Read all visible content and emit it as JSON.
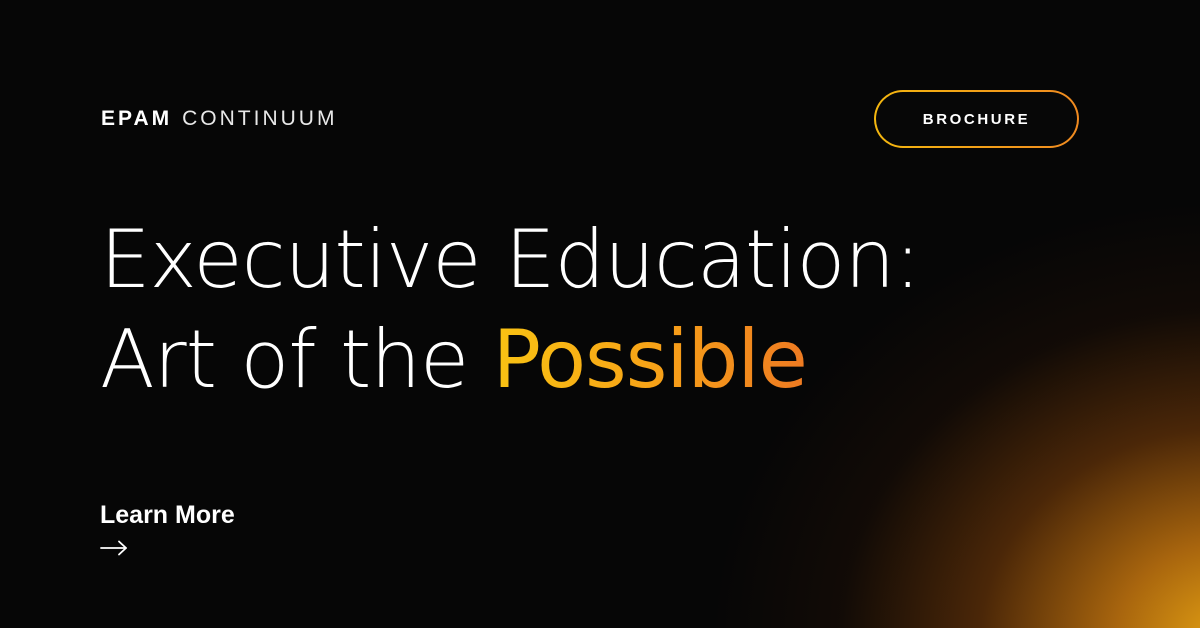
{
  "brand": {
    "strong": "EPAM",
    "light": "CONTINUUM"
  },
  "header": {
    "button_label": "BROCHURE"
  },
  "headline": {
    "line1": "Executive Education:",
    "line2_prefix": "Art of the",
    "line2_highlight": "Possible"
  },
  "cta": {
    "label": "Learn More",
    "icon": "arrow-right-icon"
  },
  "colors": {
    "background": "#060606",
    "text": "#ffffff",
    "accent_yellow": "#f9c313",
    "accent_orange": "#ee7a22"
  }
}
